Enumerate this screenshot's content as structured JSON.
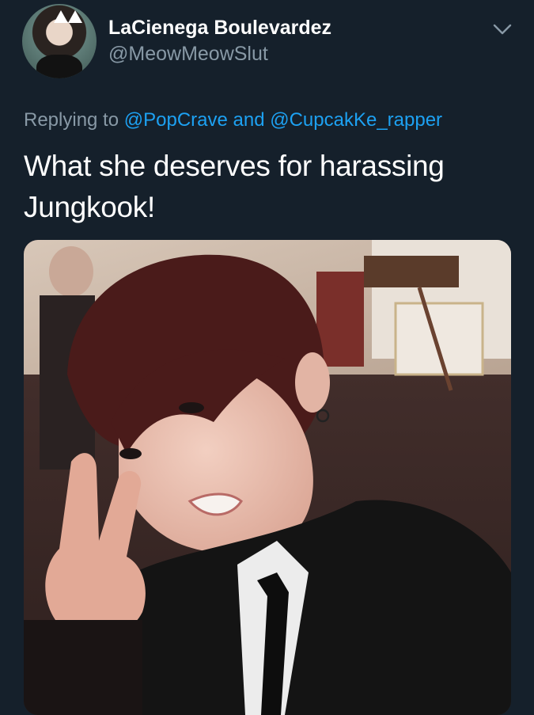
{
  "tweet": {
    "display_name": "LaCienega Boulevardez",
    "handle": "@MeowMeowSlut",
    "replying_prefix": "Replying to",
    "reply_mention_1": "@PopCrave",
    "reply_joiner": "and",
    "reply_mention_2": "@CupcakKe_rapper",
    "text": "What she deserves for harassing\nJungkook!"
  },
  "icons": {
    "menu": "chevron-down-icon",
    "avatar": "avatar-photo",
    "media": "selfie-photo"
  },
  "colors": {
    "background": "#15202b",
    "text": "#ffffff",
    "secondary_text": "#8899a6",
    "link": "#1da1f2"
  }
}
